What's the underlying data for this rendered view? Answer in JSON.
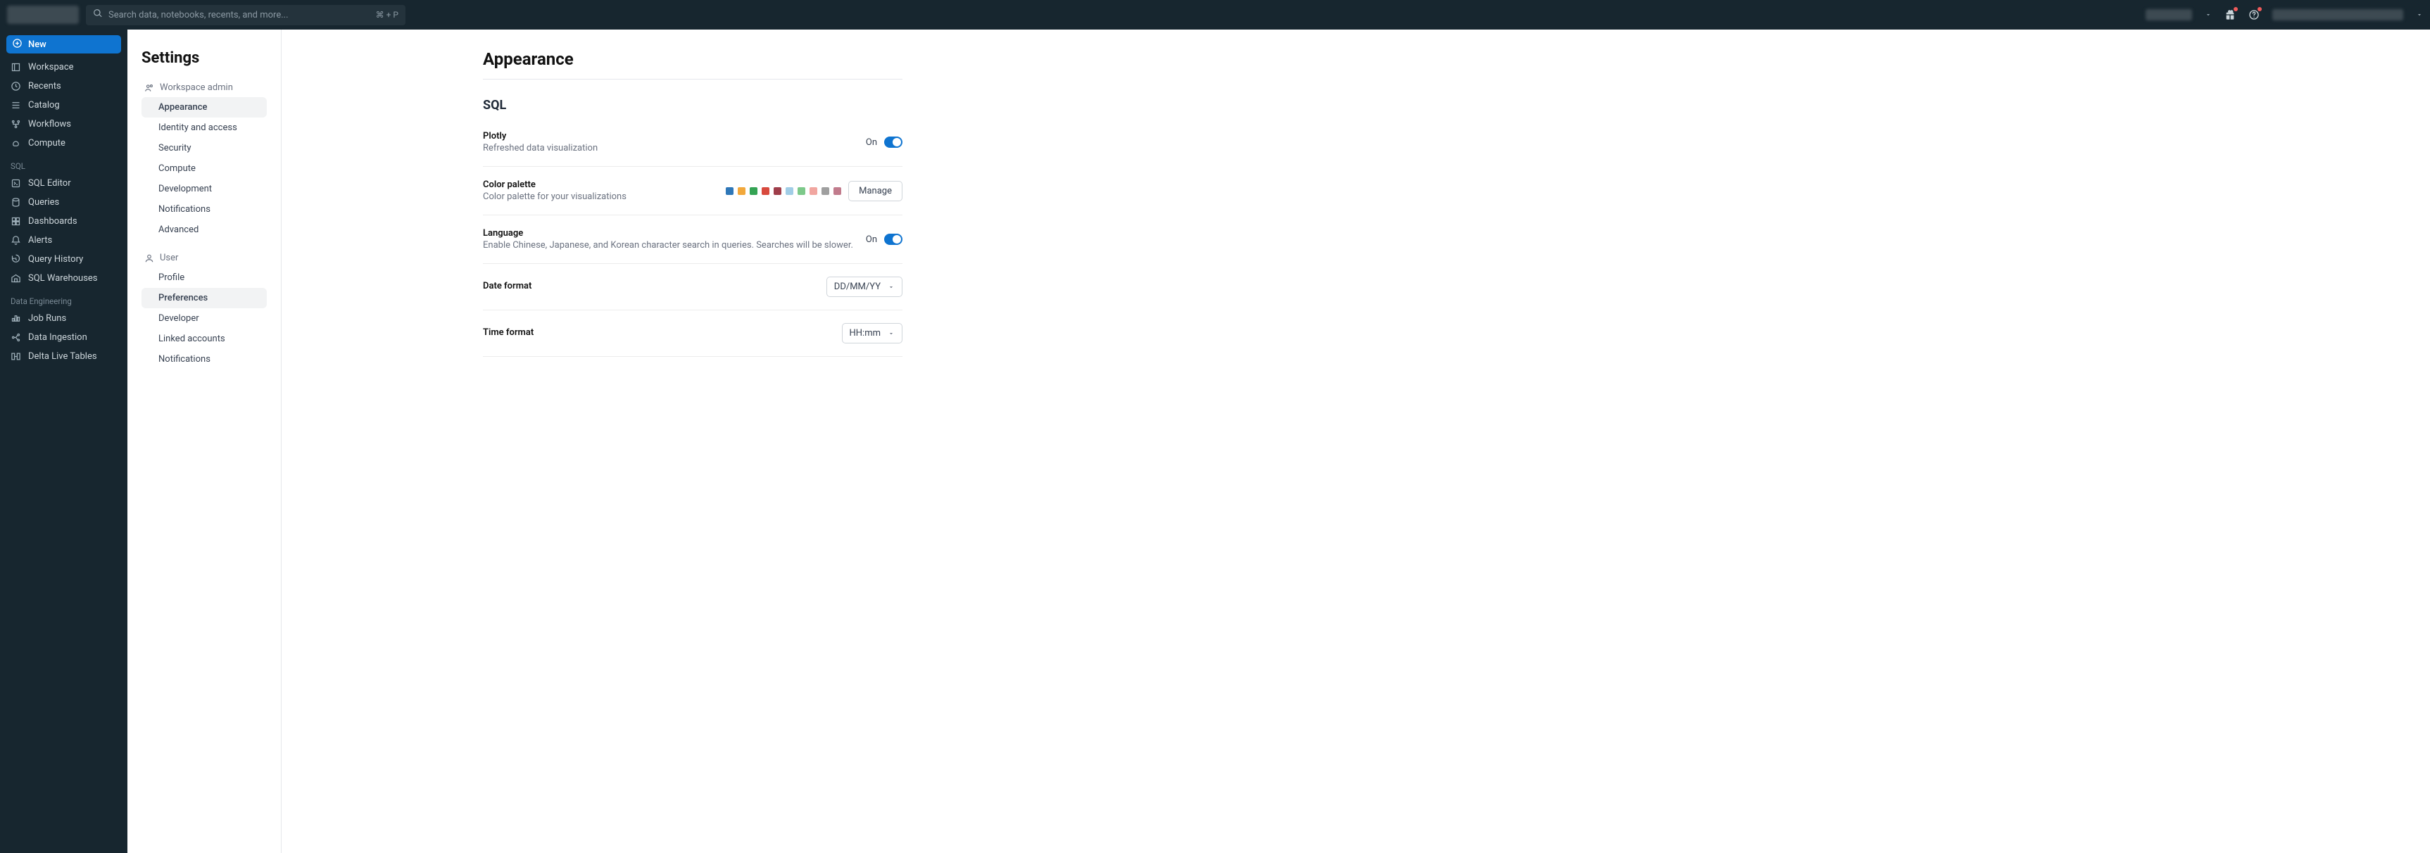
{
  "search": {
    "placeholder": "Search data, notebooks, recents, and more...",
    "shortcut": "⌘ + P"
  },
  "sidebar": {
    "new_label": "New",
    "primary": [
      {
        "label": "Workspace"
      },
      {
        "label": "Recents"
      },
      {
        "label": "Catalog"
      },
      {
        "label": "Workflows"
      },
      {
        "label": "Compute"
      }
    ],
    "sql_header": "SQL",
    "sql": [
      {
        "label": "SQL Editor"
      },
      {
        "label": "Queries"
      },
      {
        "label": "Dashboards"
      },
      {
        "label": "Alerts"
      },
      {
        "label": "Query History"
      },
      {
        "label": "SQL Warehouses"
      }
    ],
    "de_header": "Data Engineering",
    "de": [
      {
        "label": "Job Runs"
      },
      {
        "label": "Data Ingestion"
      },
      {
        "label": "Delta Live Tables"
      }
    ]
  },
  "settings_nav": {
    "title": "Settings",
    "workspace_admin_label": "Workspace admin",
    "workspace_admin": [
      "Appearance",
      "Identity and access",
      "Security",
      "Compute",
      "Development",
      "Notifications",
      "Advanced"
    ],
    "user_label": "User",
    "user": [
      "Profile",
      "Preferences",
      "Developer",
      "Linked accounts",
      "Notifications"
    ]
  },
  "content": {
    "title": "Appearance",
    "section_title": "SQL",
    "plotly": {
      "name": "Plotly",
      "desc": "Refreshed data visualization",
      "state": "On"
    },
    "palette": {
      "name": "Color palette",
      "desc": "Color palette for your visualizations",
      "manage": "Manage",
      "colors": [
        "#2E77B8",
        "#F2A83B",
        "#34A354",
        "#D84A3E",
        "#9F3E4A",
        "#A1CDE6",
        "#7DC98A",
        "#F1A6A0",
        "#9F9F9F",
        "#C17B8C"
      ]
    },
    "language": {
      "name": "Language",
      "desc": "Enable Chinese, Japanese, and Korean character search in queries. Searches will be slower.",
      "state": "On"
    },
    "date_format": {
      "name": "Date format",
      "value": "DD/MM/YY"
    },
    "time_format": {
      "name": "Time format",
      "value": "HH:mm"
    }
  }
}
